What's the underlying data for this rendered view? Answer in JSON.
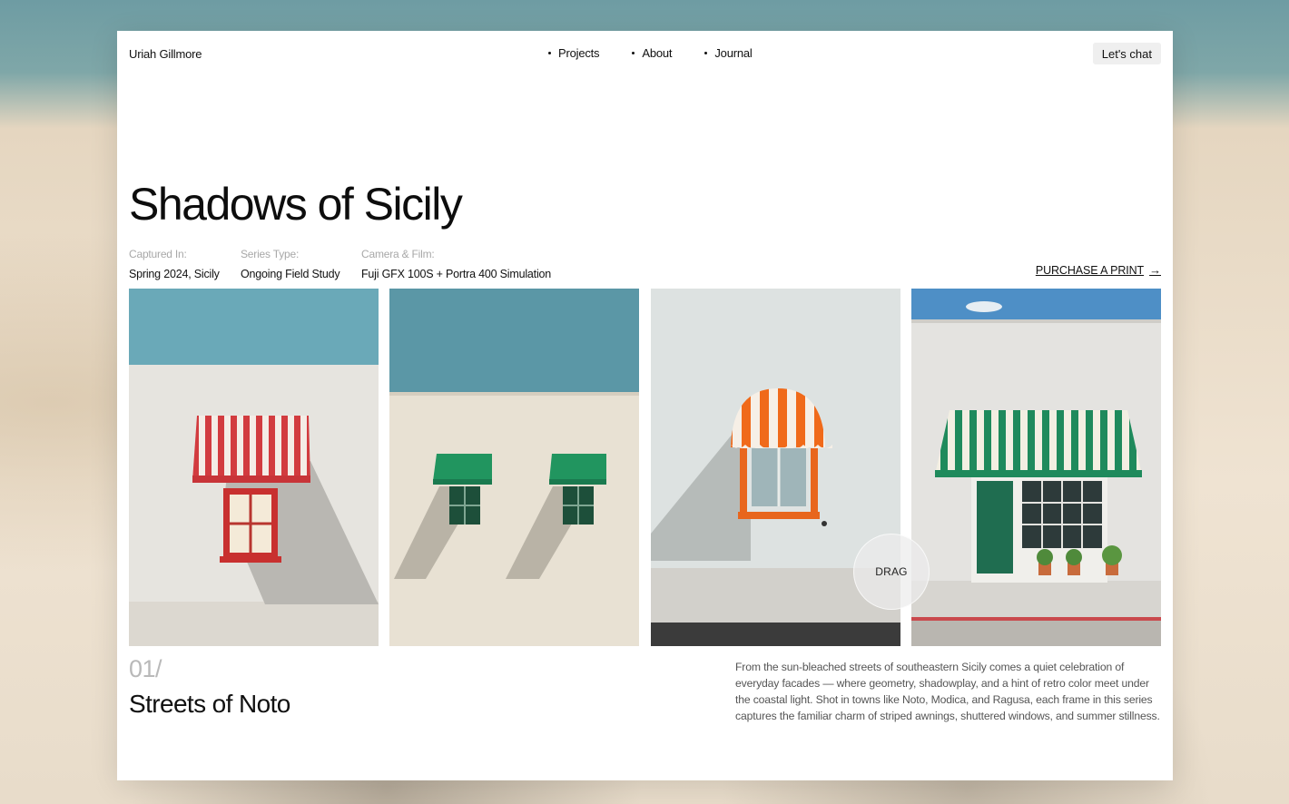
{
  "nav": {
    "brand": "Uriah Gillmore",
    "links": [
      "Projects",
      "About",
      "Journal"
    ],
    "cta": "Let's chat"
  },
  "project": {
    "title": "Shadows of Sicily",
    "meta": [
      {
        "label": "Captured In:",
        "value": "Spring 2024, Sicily"
      },
      {
        "label": "Series Type:",
        "value": "Ongoing Field Study"
      },
      {
        "label": "Camera & Film:",
        "value": "Fuji GFX 100S + Portra 400 Simulation"
      }
    ],
    "purchase_label": "PURCHASE A PRINT",
    "drag_label": "DRAG",
    "index": "01/",
    "subtitle": "Streets of Noto",
    "description": "From the sun-bleached streets of southeastern Sicily comes a quiet celebration of everyday facades — where geometry, shadowplay, and a hint of retro color meet under the coastal light. Shot in towns like Noto, Modica, and Ragusa, each frame in this series captures the familiar charm of striped awnings, shuttered windows, and summer stillness."
  },
  "colors": {
    "sky": "#6aa9b8",
    "awning_red": "#d23b3f",
    "awning_green": "#1f8a5c",
    "awning_orange": "#f06a1a"
  }
}
